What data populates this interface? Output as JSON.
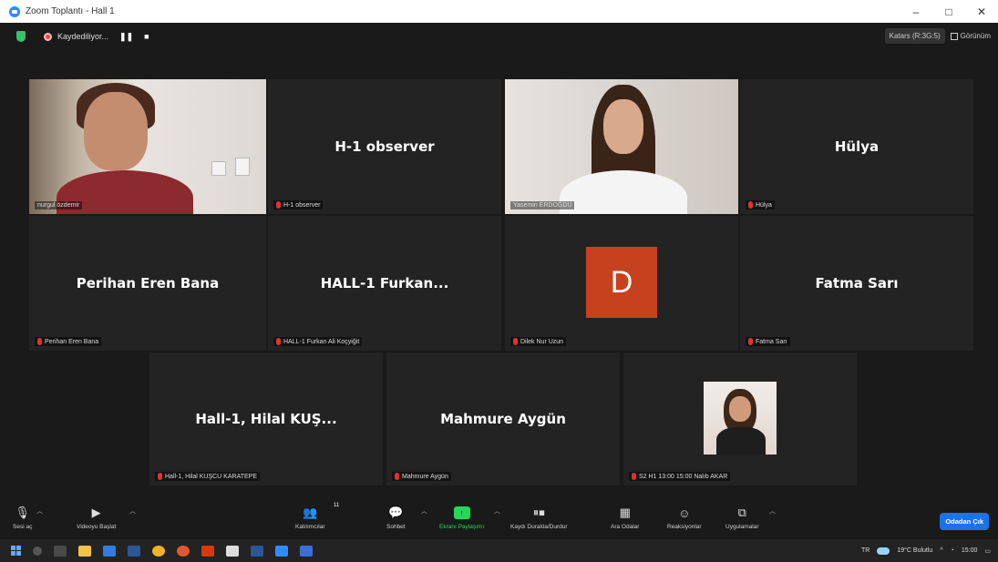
{
  "window": {
    "title": "Zoom Toplantı - Hall 1",
    "minimize": "–",
    "maximize": "□",
    "close": "✕"
  },
  "topbar": {
    "recording_label": "Kaydediliyor...",
    "pause_icon": "❚❚",
    "stop_icon": "■",
    "speaker_view_label": "Katars (R:3G:5)",
    "view_label": "Görünüm"
  },
  "tiles": [
    {
      "name": "nurgul özdemir",
      "center": "",
      "type": "video"
    },
    {
      "name": "H-1 observer",
      "center": "H-1 observer",
      "type": "name"
    },
    {
      "name": "Yasemin ERDOĞDU",
      "center": "",
      "type": "video"
    },
    {
      "name": "Hülya",
      "center": "Hülya",
      "type": "name"
    },
    {
      "name": "Perihan Eren Bana",
      "center": "Perihan Eren Bana",
      "type": "name"
    },
    {
      "name": "HALL-1 Furkan Ali Koçyiğit",
      "center": "HALL-1  Furkan...",
      "type": "name"
    },
    {
      "name": "Dilek Nur Uzun",
      "center": "",
      "avatar_letter": "D",
      "type": "avatar"
    },
    {
      "name": "Fatma Sarı",
      "center": "Fatma Sarı",
      "type": "name"
    },
    {
      "name": "Hall-1, Hilal KUŞCU KARATEPE",
      "center": "Hall-1, Hilal KUŞ...",
      "type": "name"
    },
    {
      "name": "Mahmure Aygün",
      "center": "Mahmure Aygün",
      "type": "name"
    },
    {
      "name": "S2 H1 13:00 15:00 Nalıb AKAR",
      "center": "",
      "type": "thumb"
    }
  ],
  "toolbar": {
    "mute_label": "Sesi aç",
    "video_label": "Videoyu Başlat",
    "participants_label": "Katılımcılar",
    "participants_count": "11",
    "chat_label": "Sohbet",
    "share_label": "Ekranı Paylaşımı",
    "record_label": "Kaydı Durakla/Durdur",
    "rooms_label": "Ara Odalar",
    "reactions_label": "Reaksiyonlar",
    "apps_label": "Uygulamalar",
    "leave_label": "Odadan Çık"
  },
  "taskbar": {
    "lang": "TR",
    "weather": "19°C Bulutlu",
    "time": "15:00"
  },
  "colors": {
    "active_speaker": "#c4e34c",
    "share_green": "#23d959",
    "leave_blue": "#1a73e8",
    "avatar_orange": "#c7411e"
  }
}
